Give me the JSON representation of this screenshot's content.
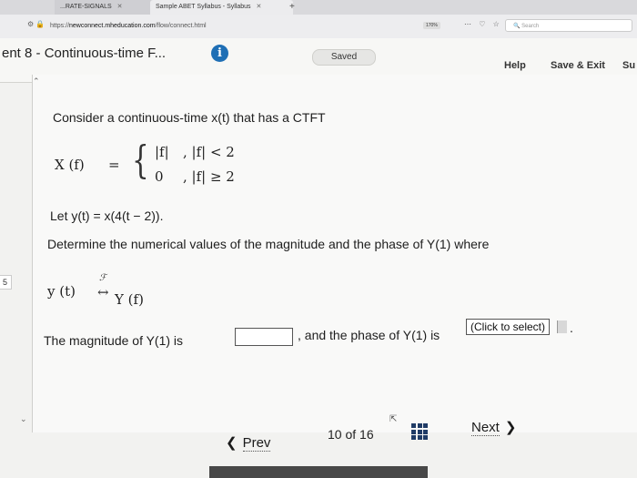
{
  "browser": {
    "tab_inactive": "...RATE-SIGNALS",
    "tab_active": "Sample ABET Syllabus - Syllabus",
    "new_tab": "+",
    "url_prefix": "https://",
    "url_host": "newconnect.mheducation.com",
    "url_path": "/flow/connect.html",
    "zoom": "170%",
    "toolbar_icons": "⋯ ♡ ☆",
    "search_placeholder": "Search"
  },
  "header": {
    "assignment_title": "ent 8 - Continuous-time F...",
    "info_icon": "i",
    "saved_label": "Saved",
    "help_label": "Help",
    "save_exit_label": "Save & Exit",
    "submit_label": "Su"
  },
  "question": {
    "number": "5",
    "intro": "Consider a continuous-time x(t) that has a CTFT",
    "xf_lhs": "X (f)",
    "equals": "=",
    "brace": "{",
    "case1_value": "|f|",
    "case1_condition": ",  |f| < 2",
    "case2_value": "0",
    "case2_condition": ",  |f| ≥ 2",
    "let_statement": "Let y(t) = x(4(t − 2)).",
    "determine": "Determine the numerical values of the magnitude and the phase of Y(1) where",
    "ft_pair_lhs": "y (t)",
    "ft_arrow": "↔",
    "ft_script": "ℱ",
    "ft_pair_rhs": "Y (f)",
    "answer_prefix": "The magnitude of Y(1) is",
    "magnitude_value": "",
    "answer_middle": ", and the phase of Y(1) is",
    "phase_select_value": "(Click to select)",
    "period": "."
  },
  "footer": {
    "prev_label": "Prev",
    "page_current": "10",
    "page_of": "of",
    "page_total": "16",
    "next_label": "Next"
  }
}
